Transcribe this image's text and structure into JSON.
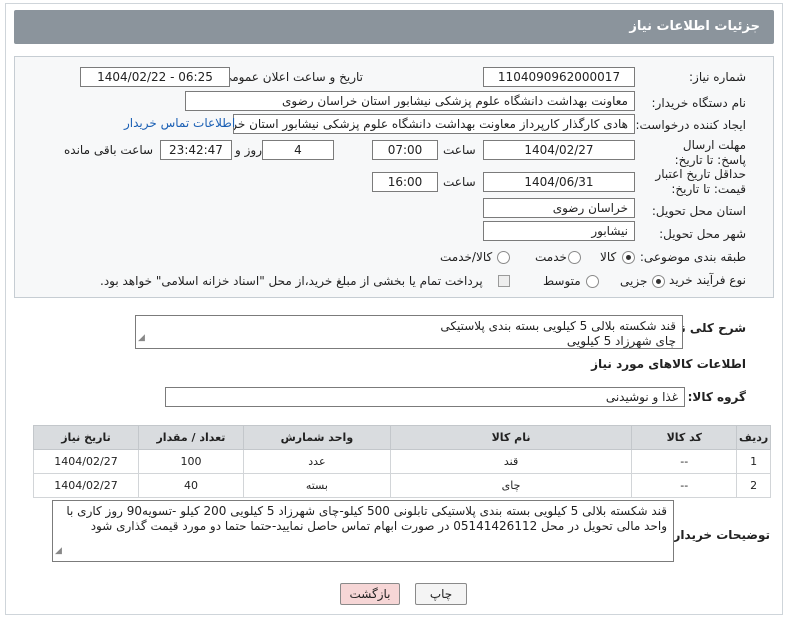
{
  "header": {
    "title": "جزئیات اطلاعات نیاز"
  },
  "form": {
    "need_number_label": "شماره نیاز:",
    "need_number": "1104090962000017",
    "announce_label": "تاریخ و ساعت اعلان عمومی:",
    "announce_value": "1404/02/22 - 06:25",
    "buyer_org_label": "نام دستگاه خریدار:",
    "buyer_org": "معاونت بهداشت دانشگاه علوم پزشکی نیشابور استان خراسان رضوی",
    "creator_label": "ایجاد کننده درخواست:",
    "creator": "هادی کارگذار کارپرداز معاونت بهداشت دانشگاه علوم پزشکی نیشابور استان خر",
    "contact_link": "اطلاعات تماس خریدار",
    "deadline_label": "مهلت ارسال پاسخ: تا تاریخ:",
    "deadline_date": "1404/02/27",
    "time_label": "ساعت",
    "deadline_time": "07:00",
    "days_value": "4",
    "days_label": "روز و",
    "remaining_value": "23:42:47",
    "remaining_label": "ساعت باقی مانده",
    "validity_label": "حداقل تاریخ اعتبار قیمت: تا تاریخ:",
    "validity_date": "1404/06/31",
    "validity_time": "16:00",
    "province_label": "استان محل تحویل:",
    "province": "خراسان رضوی",
    "city_label": "شهر محل تحویل:",
    "city": "نیشابور",
    "category_label": "طبقه بندی موضوعی:",
    "category_options": [
      "کالا",
      "خدمت",
      "کالا/خدمت"
    ],
    "category_selected": "کالا",
    "process_label": "نوع فرآیند خرید :",
    "process_options": [
      "جزیی",
      "متوسط"
    ],
    "process_selected": "جزیی",
    "payment_note": "پرداخت تمام یا بخشی از مبلغ خرید،از محل \"اسناد خزانه اسلامی\" خواهد بود."
  },
  "summary": {
    "label": "شرح کلی نیاز:",
    "line1": "قند شکسته بلالی 5 کیلویی بسته بندی پلاستیکی",
    "line2": "چای شهرزاد 5 کیلویی"
  },
  "goods": {
    "section_title": "اطلاعات کالاهای مورد نیاز",
    "group_label": "گروه کالا:",
    "group_value": "غذا و نوشیدنی",
    "columns": [
      "ردیف",
      "کد کالا",
      "نام کالا",
      "واحد شمارش",
      "تعداد / مقدار",
      "تاریخ نیاز"
    ],
    "rows": [
      {
        "row": "1",
        "code": "--",
        "name": "قند",
        "unit": "عدد",
        "qty": "100",
        "date": "1404/02/27"
      },
      {
        "row": "2",
        "code": "--",
        "name": "چای",
        "unit": "بسته",
        "qty": "40",
        "date": "1404/02/27"
      }
    ]
  },
  "notes": {
    "label": "توضیحات خریدار:",
    "text": "قند شکسته بلالی 5 کیلویی بسته بندی پلاستیکی تابلونی 500 کیلو-چای شهرزاد 5 کیلویی 200 کیلو -تسویه90 روز کاری با واحد مالی تحویل در محل 05141426112 در صورت ابهام تماس حاصل نمایید-حتما حتما دو مورد قیمت گذاری شود"
  },
  "buttons": {
    "print": "چاپ",
    "back": "بازگشت"
  },
  "colors": {
    "header_bg": "#8b949c",
    "link": "#1a5fb4",
    "back_button_bg": "#f6d6d6"
  }
}
